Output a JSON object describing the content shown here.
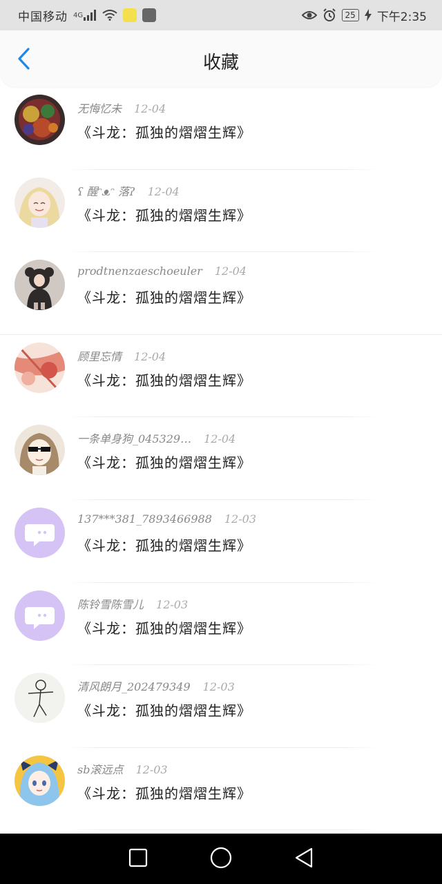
{
  "status_bar": {
    "carrier": "中国移动",
    "network": "4G",
    "battery": "25",
    "time": "下午2:35"
  },
  "header": {
    "title": "收藏",
    "back_icon": "chevron-left-icon",
    "accent": "#1e88e5"
  },
  "items": [
    {
      "user": "无悔忆未",
      "date": "12-04",
      "title": "《斗龙：孤独的熠熠生辉》",
      "avatar": "colorful-art"
    },
    {
      "user": "ʕ 醒ᵔᴥᵔ 落ʔ",
      "date": "12-04",
      "title": "《斗龙：孤独的熠熠生辉》",
      "avatar": "anime-girl-blonde"
    },
    {
      "user": "prodtnenzaeschoeuler",
      "date": "12-04",
      "title": "《斗龙：孤独的熠熠生辉》",
      "avatar": "child-bear-costume"
    },
    {
      "user": "顾里忘情",
      "date": "12-04",
      "title": "《斗龙：孤独的熠熠生辉》",
      "avatar": "floral-red"
    },
    {
      "user": "一条单身狗_045329…",
      "date": "12-04",
      "title": "《斗龙：孤独的熠熠生辉》",
      "avatar": "anime-sunglasses"
    },
    {
      "user": "137***381_7893466988",
      "date": "12-03",
      "title": "《斗龙：孤独的熠熠生辉》",
      "avatar": "default-chat-purple"
    },
    {
      "user": "陈铃雪陈雪儿",
      "date": "12-03",
      "title": "《斗龙：孤独的熠熠生辉》",
      "avatar": "default-chat-purple"
    },
    {
      "user": "清风朗月_202479349",
      "date": "12-03",
      "title": "《斗龙：孤独的熠熠生辉》",
      "avatar": "stick-figure"
    },
    {
      "user": "sb滚远点",
      "date": "12-03",
      "title": "《斗龙：孤独的熠熠生辉》",
      "avatar": "anime-blue-hair"
    }
  ],
  "nav": {
    "recent_icon": "square-icon",
    "home_icon": "circle-icon",
    "back_icon": "triangle-back-icon"
  }
}
